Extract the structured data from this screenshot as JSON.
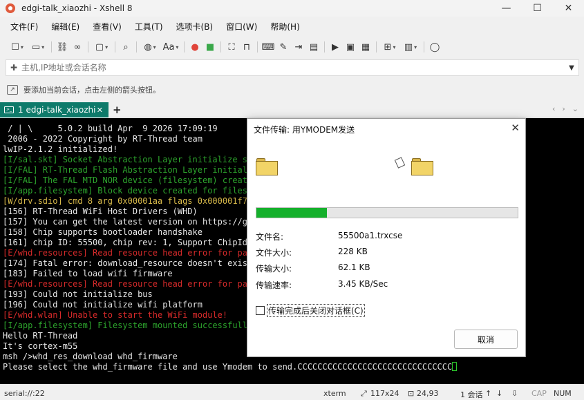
{
  "window": {
    "title": "edgi-talk_xiaozhi - Xshell 8"
  },
  "menu": [
    "文件(F)",
    "编辑(E)",
    "查看(V)",
    "工具(T)",
    "选项卡(B)",
    "窗口(W)",
    "帮助(H)"
  ],
  "toolbar": {
    "font_label": "Aa"
  },
  "address": {
    "placeholder": "主机,IP地址或会话名称"
  },
  "hint": {
    "text": "要添加当前会话，点击左侧的箭头按钮。"
  },
  "tabs": [
    {
      "label": "1 edgi-talk_xiaozhi"
    }
  ],
  "terminal": {
    "lines": [
      {
        "text": " / | \\     5.0.2 build Apr  9 2026 17:09:19",
        "color": "w"
      },
      {
        "text": " 2006 - 2022 Copyright by RT-Thread team",
        "color": "w"
      },
      {
        "text": "lwIP-2.1.2 initialized!",
        "color": "w"
      },
      {
        "text": "[I/sal.skt] Socket Abstraction Layer initialize suc",
        "color": "g"
      },
      {
        "text": "[I/FAL] RT-Thread Flash Abstraction Layer initializ",
        "color": "g"
      },
      {
        "text": "[I/FAL] The FAL MTD NOR device (filesystem) created",
        "color": "g"
      },
      {
        "text": "[I/app.filesystem] Block device created for filesys",
        "color": "g"
      },
      {
        "text": "[W/drv.sdio] cmd 8 arg 0x00001aa flags 0x000001f7",
        "color": "y"
      },
      {
        "text": "[156] RT-Thread WiFi Host Drivers (WHD)",
        "color": "w"
      },
      {
        "text": "[157] You can get the latest version on https://git",
        "color": "w"
      },
      {
        "text": "[158] Chip supports bootloader handshake",
        "color": "w"
      },
      {
        "text": "[161] chip ID: 55500, chip rev: 1, Support ChipId R",
        "color": "w"
      },
      {
        "text": "[E/whd.resources] Read resource head error for par",
        "color": "r"
      },
      {
        "text": "[174] Fatal error: download_resource doesn't exist",
        "color": "w"
      },
      {
        "text": "[183] Failed to load wifi firmware",
        "color": "w"
      },
      {
        "text": "[E/whd.resources] Read resource head error for par",
        "color": "r"
      },
      {
        "text": "[193] Could not initialize bus",
        "color": "w"
      },
      {
        "text": "[196] Could not initialize wifi platform",
        "color": "w"
      },
      {
        "text": "[E/whd.wlan] Unable to start the WiFi module!",
        "color": "r"
      },
      {
        "text": "[I/app.filesystem] Filesystem mounted successfully",
        "color": "g"
      },
      {
        "text": "Hello RT-Thread",
        "color": "w"
      },
      {
        "text": "It's cortex-m55",
        "color": "w"
      },
      {
        "text": "msh />whd_res_download whd_firmware",
        "color": "w"
      },
      {
        "text": "Please select the whd_firmware file and use Ymodem to send.CCCCCCCCCCCCCCCCCCCCCCCCCCCCCCC",
        "color": "w"
      }
    ]
  },
  "status": {
    "connection": "serial://:22",
    "term_type": "xterm",
    "size": "117x24",
    "cursor_pos": "24,93",
    "sessions": "1 会话",
    "caps": "CAP",
    "num": "NUM"
  },
  "dialog": {
    "title": "文件传输: 用YMODEM发送",
    "progress": 0.27,
    "fields": [
      {
        "label": "文件名:",
        "value": "55500a1.trxcse"
      },
      {
        "label": "文件大小:",
        "value": "228 KB"
      },
      {
        "label": "传输大小:",
        "value": "62.1 KB"
      },
      {
        "label": "传输速率:",
        "value": "3.45 KB/Sec"
      }
    ],
    "checkbox_label": "传输完成后关闭对话框(C)",
    "cancel_label": "取消"
  },
  "colors": {
    "tab_active": "#0e7a6a",
    "progress": "#15b02c",
    "term_green": "#2da52d",
    "term_red": "#d62a2a"
  }
}
